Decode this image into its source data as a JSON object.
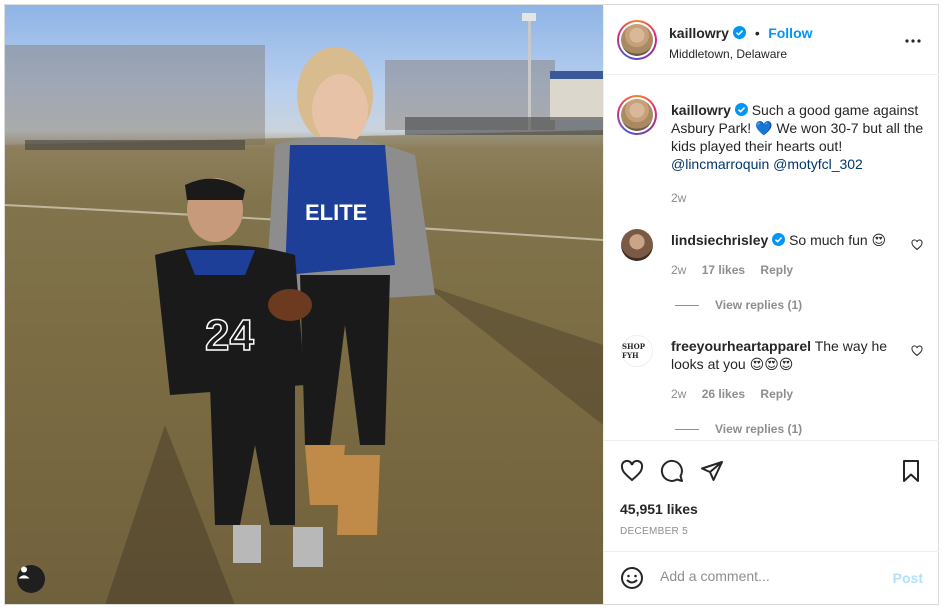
{
  "post": {
    "author": "kaillowry",
    "verified": true,
    "follow_label": "Follow",
    "separator": "•",
    "location": "Middletown, Delaware",
    "more_icon": "more-horizontal-icon",
    "photo_alt": "photo"
  },
  "caption": {
    "author": "kaillowry",
    "text_parts": [
      "Such a good game against Asbury Park! ",
      "💙",
      " We won 30-7 but all the kids played their hearts out!"
    ],
    "mention_1": "@lincmarroquin",
    "mention_2": "@motyfcl_302",
    "age": "2w"
  },
  "comments": [
    {
      "author": "lindsiechrisley",
      "verified": true,
      "text": "So much fun 😍",
      "age": "2w",
      "likes": "17 likes",
      "reply_label": "Reply",
      "view_replies": "View replies (1)"
    },
    {
      "author": "freeyourheartapparel",
      "verified": false,
      "text": "The way he looks at you 😍😍😍",
      "avatar_text": "SHOP FYH",
      "age": "2w",
      "likes": "26 likes",
      "reply_label": "Reply",
      "view_replies": "View replies (1)"
    }
  ],
  "engagement": {
    "likes": "45,951 likes",
    "date": "DECEMBER 5"
  },
  "composer": {
    "placeholder": "Add a comment...",
    "post_label": "Post"
  },
  "colors": {
    "link": "#0095f6",
    "mention": "#00376b",
    "muted": "#8e8e8e",
    "post_disabled": "#b2dffc"
  }
}
